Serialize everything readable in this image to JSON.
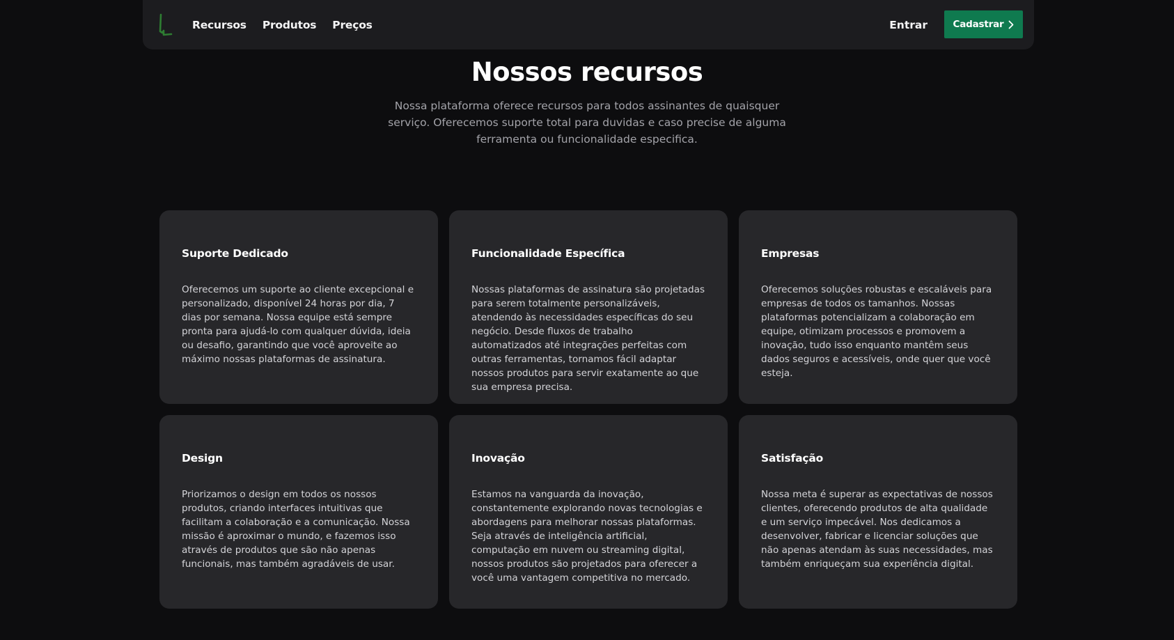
{
  "nav": {
    "links": [
      "Recursos",
      "Produtos",
      "Preços"
    ],
    "login_label": "Entrar",
    "signup_label": "Cadastrar",
    "logo_icon": "logo-icon",
    "logo_color": "#2e7d32",
    "accent_color": "#0f7a4f"
  },
  "hero": {
    "title": "Nossos recursos",
    "subtitle": "Nossa plataforma oferece recursos para todos assinantes de quaisquer serviço. Oferecemos suporte total para duvidas e caso precise de alguma ferramenta ou funcionalidade especifica."
  },
  "features": [
    {
      "title": "Suporte Dedicado",
      "description": "Oferecemos um suporte ao cliente excepcional e personalizado, disponível 24 horas por dia, 7 dias por semana. Nossa equipe está sempre pronta para ajudá-lo com qualquer dúvida, ideia ou desafio, garantindo que você aproveite ao máximo nossas plataformas de assinatura."
    },
    {
      "title": "Funcionalidade Específica",
      "description": "Nossas plataformas de assinatura são projetadas para serem totalmente personalizáveis, atendendo às necessidades específicas do seu negócio. Desde fluxos de trabalho automatizados até integrações perfeitas com outras ferramentas, tornamos fácil adaptar nossos produtos para servir exatamente ao que sua empresa precisa."
    },
    {
      "title": "Empresas",
      "description": "Oferecemos soluções robustas e escaláveis para empresas de todos os tamanhos. Nossas plataformas potencializam a colaboração em equipe, otimizam processos e promovem a inovação, tudo isso enquanto mantêm seus dados seguros e acessíveis, onde quer que você esteja."
    },
    {
      "title": "Design",
      "description": "Priorizamos o design em todos os nossos produtos, criando interfaces intuitivas que facilitam a colaboração e a comunicação. Nossa missão é aproximar o mundo, e fazemos isso através de produtos que são não apenas funcionais, mas também agradáveis de usar."
    },
    {
      "title": "Inovação",
      "description": "Estamos na vanguarda da inovação, constantemente explorando novas tecnologias e abordagens para melhorar nossas plataformas. Seja através de inteligência artificial, computação em nuvem ou streaming digital, nossos produtos são projetados para oferecer a você uma vantagem competitiva no mercado."
    },
    {
      "title": "Satisfação",
      "description": "Nossa meta é superar as expectativas de nossos clientes, oferecendo produtos de alta qualidade e um serviço impecável. Nos dedicamos a desenvolver, fabricar e licenciar soluções que não apenas atendam às suas necessidades, mas também enriqueçam sua experiência digital."
    }
  ]
}
